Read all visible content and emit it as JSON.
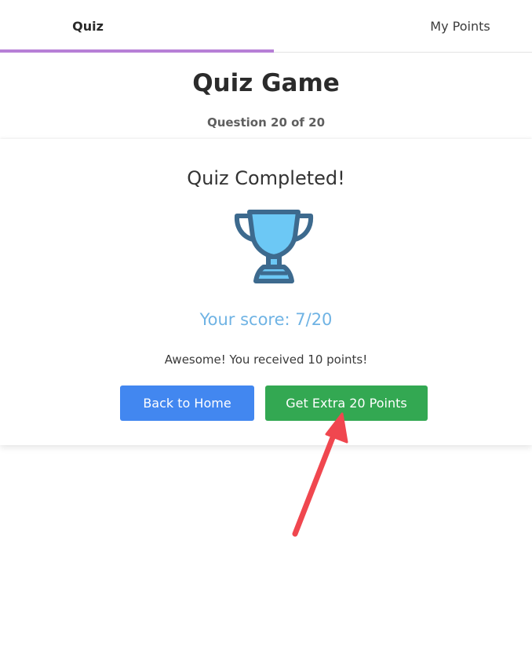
{
  "tabs": [
    {
      "label": "Quiz",
      "active": true
    },
    {
      "label": "My Points",
      "active": false
    }
  ],
  "header": {
    "title": "Quiz Game",
    "question_counter": "Question 20 of 20"
  },
  "result": {
    "title": "Quiz Completed!",
    "icon": "trophy-icon",
    "score": "Your score: 7/20",
    "message": "Awesome! You received 10 points!"
  },
  "buttons": {
    "back_home": "Back to Home",
    "extra_points": "Get Extra 20 Points"
  },
  "colors": {
    "tab_indicator": "#b77fd6",
    "score_text": "#6fb3e4",
    "back_button": "#4287f0",
    "extra_button": "#33a852",
    "trophy_fill": "#6cc8f5",
    "trophy_stroke": "#3d6a8e",
    "annotation_arrow": "#f0474f"
  }
}
